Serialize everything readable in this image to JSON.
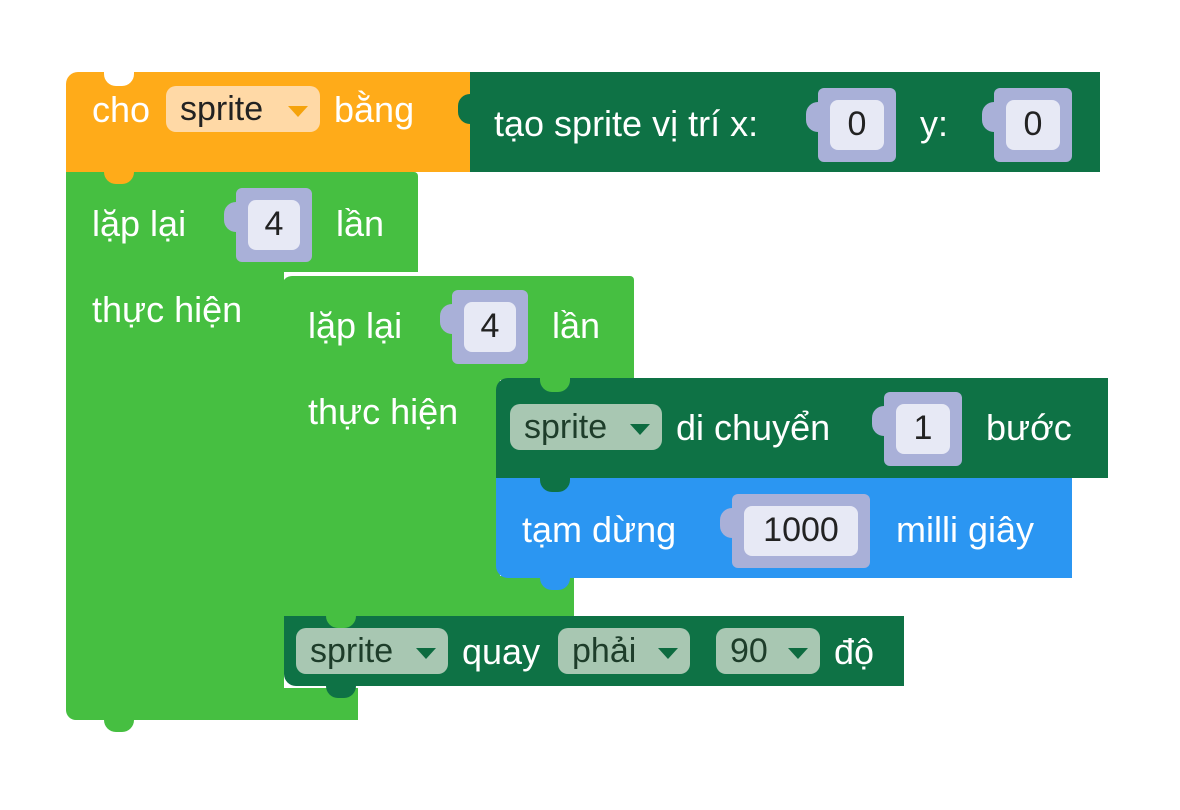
{
  "blocks": {
    "set_var": {
      "label_cho": "cho",
      "variable": "sprite",
      "label_bang": "bằng"
    },
    "create_sprite": {
      "label": "tạo sprite vị trí x:",
      "x_value": "0",
      "label_y": "y:",
      "y_value": "0"
    },
    "outer_repeat": {
      "label_lap_lai": "lặp lại",
      "times": "4",
      "label_lan": "lần",
      "label_thuc_hien": "thực hiện"
    },
    "inner_repeat": {
      "label_lap_lai": "lặp lại",
      "times": "4",
      "label_lan": "lần",
      "label_thuc_hien": "thực hiện"
    },
    "move": {
      "variable": "sprite",
      "label": "di chuyển",
      "steps": "1",
      "label_buoc": "bước"
    },
    "pause": {
      "label": "tạm dừng",
      "ms": "1000",
      "label_unit": "milli giây"
    },
    "turn": {
      "variable": "sprite",
      "label_quay": "quay",
      "direction": "phải",
      "degrees": "90",
      "label_do": "độ"
    }
  },
  "colors": {
    "variable_block": "#ffab19",
    "sprite_block": "#0e7245",
    "loop_block": "#46bf41",
    "control_block": "#2b96f2",
    "value_socket": "#a9b0d8"
  }
}
